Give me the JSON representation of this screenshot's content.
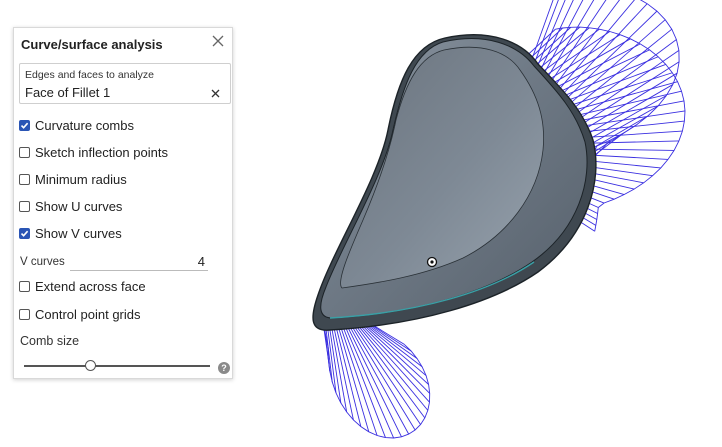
{
  "panel": {
    "title": "Curve/surface analysis",
    "select": {
      "label": "Edges and faces to analyze",
      "value": "Face of Fillet 1"
    },
    "options": [
      {
        "label": "Curvature combs",
        "checked": true
      },
      {
        "label": "Sketch inflection points",
        "checked": false
      },
      {
        "label": "Minimum radius",
        "checked": false
      },
      {
        "label": "Show U curves",
        "checked": false
      },
      {
        "label": "Show V curves",
        "checked": true
      }
    ],
    "v_curves": {
      "label": "V curves",
      "value": "4"
    },
    "options2": [
      {
        "label": "Extend across face",
        "checked": false
      },
      {
        "label": "Control point grids",
        "checked": false
      }
    ],
    "comb_size": {
      "label": "Comb size",
      "level": 0.35
    },
    "icons": {
      "close": "close-icon",
      "clear": "clear-icon",
      "help": "help-icon",
      "check": "checkmark-icon"
    }
  },
  "viewport": {
    "part_color": "#6f7a86",
    "comb_color": "#3a2fe0"
  }
}
